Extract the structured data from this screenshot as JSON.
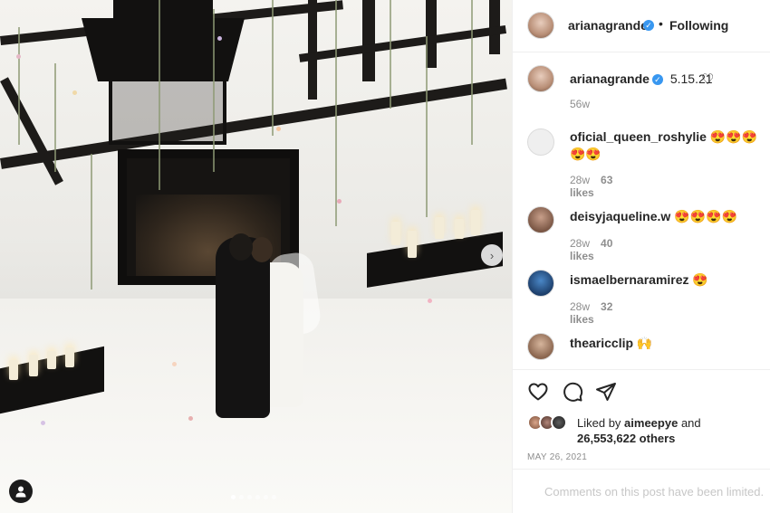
{
  "post": {
    "author": "arianagrande",
    "follow_status": "Following",
    "separator": "•",
    "caption": "5.15.21",
    "caption_age": "56w",
    "date": "MAY 26, 2021"
  },
  "carousel": {
    "slide_count": 6,
    "active_index": 0,
    "next_glyph": "›"
  },
  "comments": [
    {
      "user": "oficial_queen_roshylie",
      "text": "😍😍😍😍😍",
      "age": "28w",
      "likes": "63 likes"
    },
    {
      "user": "deisyjaqueline.w",
      "text": "😍😍😍😍",
      "age": "28w",
      "likes": "40 likes"
    },
    {
      "user": "ismaelbernaramirez",
      "text": "😍",
      "age": "28w",
      "likes": "32 likes"
    },
    {
      "user": "thearicclip",
      "text": "🙌"
    }
  ],
  "likes": {
    "prefix": "Liked by",
    "user": "aimeepye",
    "mid": "and",
    "count": "26,553,622 others"
  },
  "footer": {
    "limited_text": "Comments on this post have been limited."
  },
  "icons": {
    "verified": "verified-badge-icon",
    "heart": "heart-icon",
    "comment": "comment-icon",
    "share": "share-icon",
    "tag": "user-tag-icon",
    "next": "chevron-right-icon"
  },
  "colors": {
    "verified_blue": "#3897f0",
    "text": "#262626",
    "muted": "#8e8e8e",
    "limited": "#c7c7c7"
  }
}
